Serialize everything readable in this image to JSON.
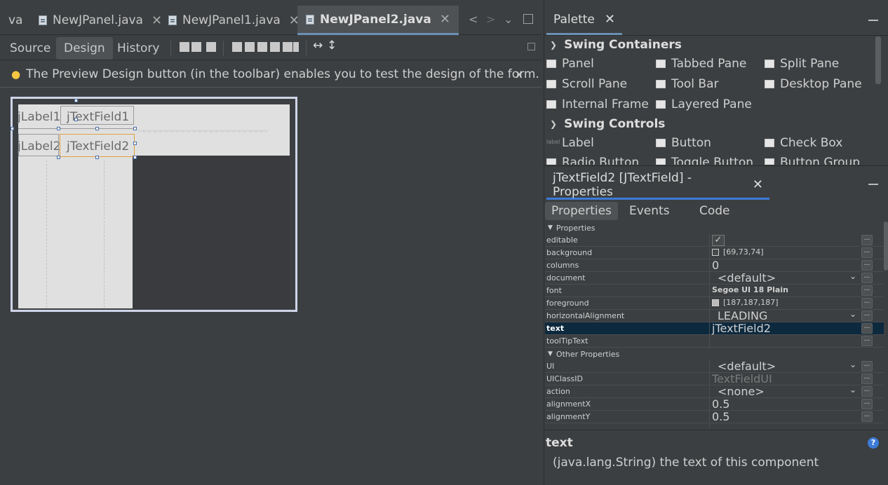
{
  "editor_tabs": [
    {
      "label": "va",
      "active": false
    },
    {
      "label": "NewJPanel.java",
      "active": false
    },
    {
      "label": "NewJPanel1.java",
      "active": false
    },
    {
      "label": "NewJPanel2.java",
      "active": true
    }
  ],
  "tab_close_glyph": "✕",
  "view_tabs": {
    "source": "Source",
    "design": "Design",
    "history": "History"
  },
  "toolbar": {
    "align_h_glyph": "↔",
    "align_v_glyph": "↕"
  },
  "info_bar": {
    "message": "The Preview Design button (in the toolbar) enables you to test the design of the form.",
    "close": "x"
  },
  "form": {
    "label1": "jLabel1",
    "textfield1": "jTextField1",
    "label2": "jLabel2",
    "textfield2": "jTextField2"
  },
  "palette": {
    "title": "Palette",
    "categories": [
      {
        "name": "Swing Containers",
        "items": [
          "Panel",
          "Tabbed Pane",
          "Split Pane",
          "Scroll Pane",
          "Tool Bar",
          "Desktop Pane",
          "Internal Frame",
          "Layered Pane"
        ]
      },
      {
        "name": "Swing Controls",
        "items": [
          "Label",
          "Button",
          "Check Box",
          "Radio Button",
          "Toggle Button",
          "Button Group"
        ]
      }
    ]
  },
  "properties_panel": {
    "title": "jTextField2 [JTextField] - Properties",
    "tabs": [
      "Properties",
      "Events",
      "Code"
    ],
    "section1": "Properties",
    "rows1": [
      {
        "name": "editable",
        "value": "✓",
        "kind": "check"
      },
      {
        "name": "background",
        "value": "[69,73,74]",
        "kind": "color",
        "color": "#45494a"
      },
      {
        "name": "columns",
        "value": "0",
        "kind": "big"
      },
      {
        "name": "document",
        "value": "<default>",
        "kind": "dropdown"
      },
      {
        "name": "font",
        "value": "Segoe UI 18 Plain",
        "kind": "bold"
      },
      {
        "name": "foreground",
        "value": "[187,187,187]",
        "kind": "color",
        "color": "#bbbbbb"
      },
      {
        "name": "horizontalAlignment",
        "value": "LEADING",
        "kind": "dropdown"
      },
      {
        "name": "text",
        "value": "jTextField2",
        "kind": "big",
        "selected": true
      },
      {
        "name": "toolTipText",
        "value": "",
        "kind": "text"
      }
    ],
    "section2": "Other Properties",
    "rows2": [
      {
        "name": "UI",
        "value": "<default>",
        "kind": "dropdown"
      },
      {
        "name": "UIClassID",
        "value": "TextFieldUI",
        "kind": "gray"
      },
      {
        "name": "action",
        "value": "<none>",
        "kind": "dropdown"
      },
      {
        "name": "alignmentX",
        "value": "0.5",
        "kind": "big"
      },
      {
        "name": "alignmentY",
        "value": "0.5",
        "kind": "big"
      }
    ],
    "description": {
      "title": "text",
      "text": "(java.lang.String) the text of this component",
      "help": "?"
    }
  },
  "colors": {
    "accent": "#3d7bd8",
    "selection_row": "#0d293e",
    "background": "#3c3f41"
  }
}
